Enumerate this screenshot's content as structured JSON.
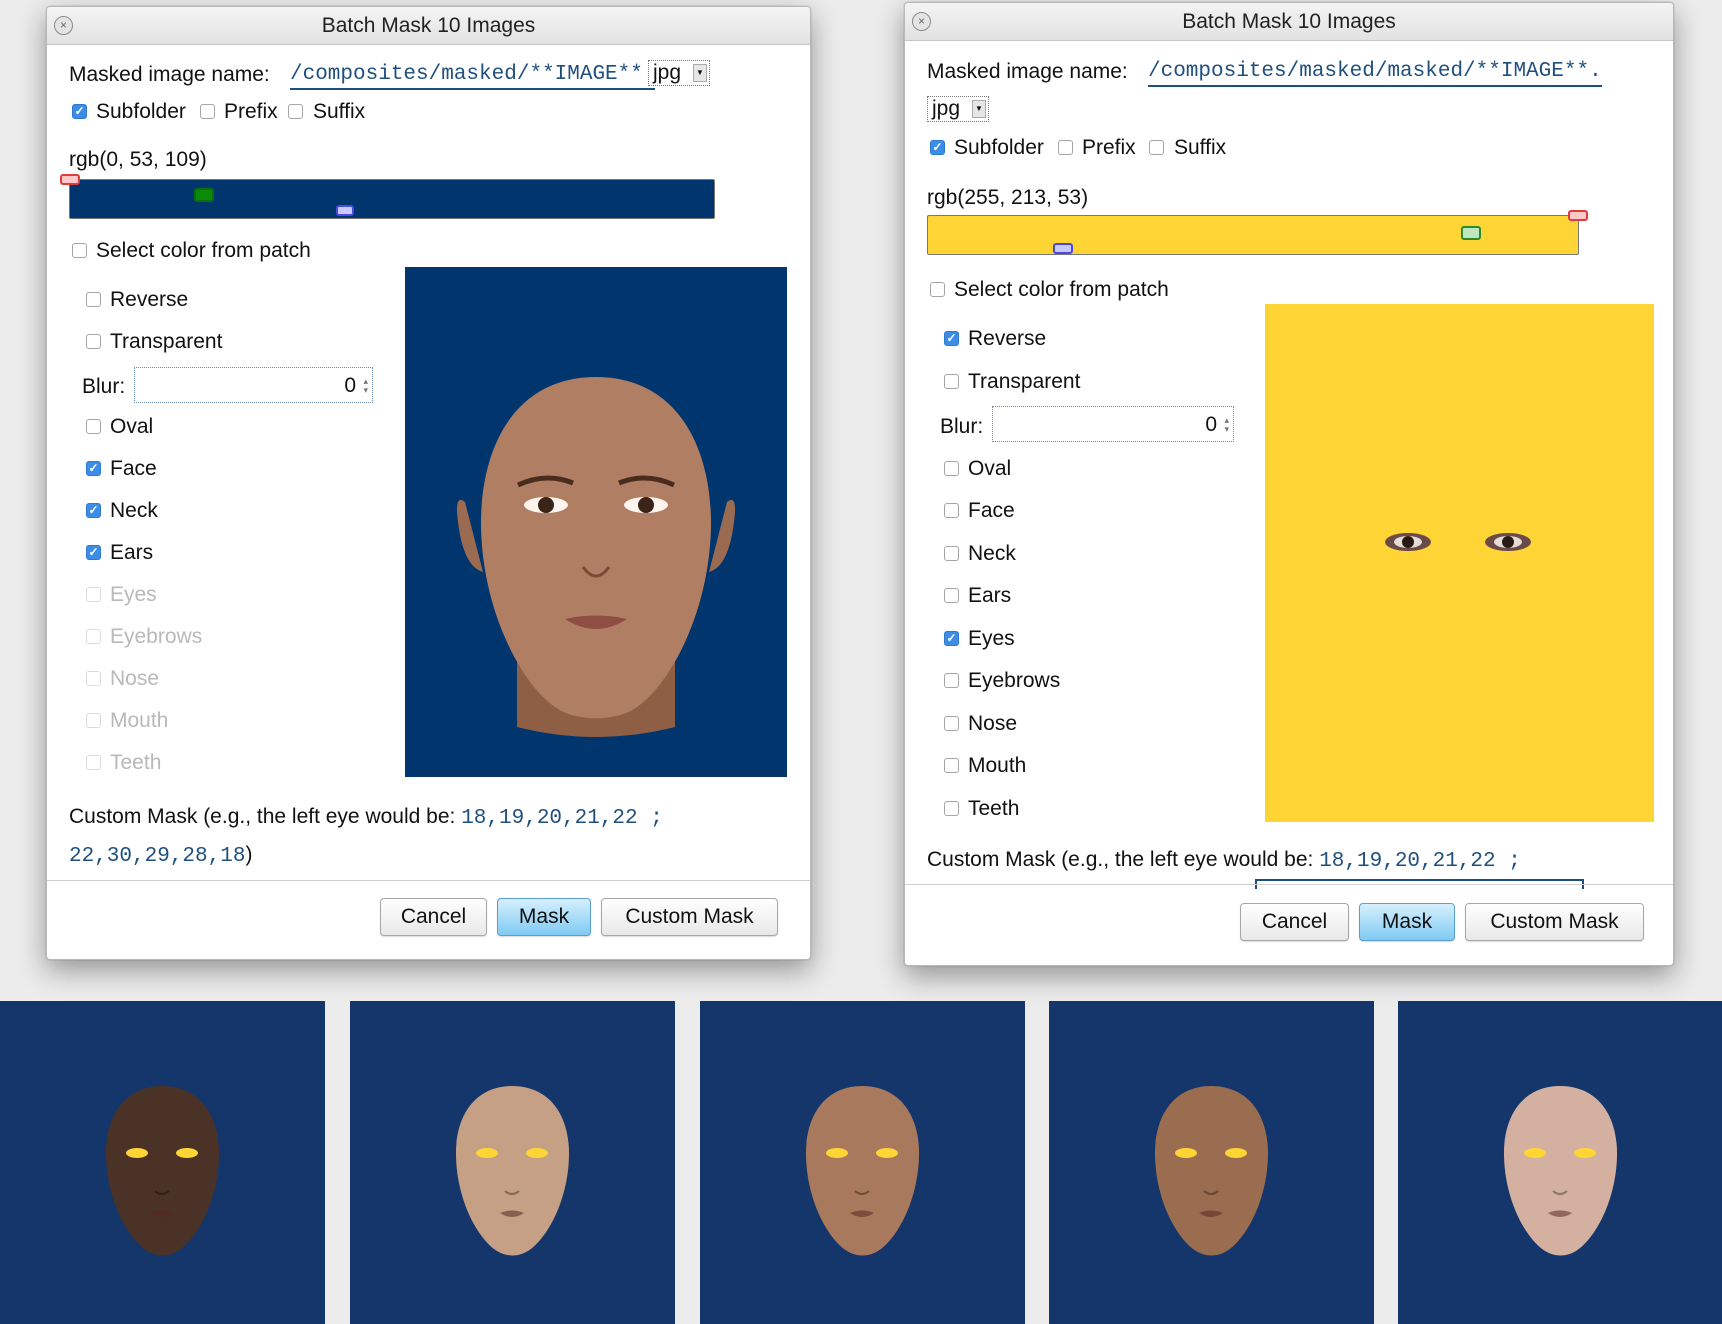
{
  "colors": {
    "blue_background": "#00356D",
    "yellow_background": "#FFD535",
    "accent_checkbox": "#3b8ee8",
    "code_text": "#1f4f7f",
    "primary_button": "#7fcaf3"
  },
  "left_dialog": {
    "title": "Batch Mask 10 Images",
    "name_label": "Masked image name:",
    "name_value": "/composites/masked/**IMAGE**.",
    "format": "jpg",
    "subfolder": "Subfolder",
    "subfolder_checked": true,
    "prefix": "Prefix",
    "prefix_checked": false,
    "suffix": "Suffix",
    "suffix_checked": false,
    "color_value": "rgb(0, 53, 109)",
    "slider_levels": {
      "red": 0,
      "green": 53,
      "blue": 109
    },
    "select_patch": "Select color from patch",
    "reverse": "Reverse",
    "transparent": "Transparent",
    "blur_label": "Blur:",
    "blur_value": "0",
    "parts": [
      {
        "label": "Oval",
        "checked": false,
        "enabled": true
      },
      {
        "label": "Face",
        "checked": true,
        "enabled": true
      },
      {
        "label": "Neck",
        "checked": true,
        "enabled": true
      },
      {
        "label": "Ears",
        "checked": true,
        "enabled": true
      },
      {
        "label": "Eyes",
        "checked": false,
        "enabled": false
      },
      {
        "label": "Eyebrows",
        "checked": false,
        "enabled": false
      },
      {
        "label": "Nose",
        "checked": false,
        "enabled": false
      },
      {
        "label": "Mouth",
        "checked": false,
        "enabled": false
      },
      {
        "label": "Teeth",
        "checked": false,
        "enabled": false
      }
    ],
    "custom_mask_text": "Custom Mask (e.g., the left eye would be:",
    "custom_mask_code_1": "18,19,20,21,22 ;",
    "custom_mask_code_2": "22,30,29,28,18",
    "custom_mask_close": ")",
    "cancel": "Cancel",
    "mask": "Mask",
    "custom_mask_button": "Custom Mask"
  },
  "right_dialog": {
    "title": "Batch Mask 10 Images",
    "name_label": "Masked image name:",
    "name_value": "/composites/masked/masked/**IMAGE**.",
    "format": "jpg",
    "subfolder": "Subfolder",
    "subfolder_checked": true,
    "prefix": "Prefix",
    "prefix_checked": false,
    "suffix": "Suffix",
    "suffix_checked": false,
    "color_value": "rgb(255, 213, 53)",
    "slider_levels": {
      "red": 255,
      "green": 213,
      "blue": 53
    },
    "select_patch": "Select color from patch",
    "reverse": "Reverse",
    "reverse_checked": true,
    "transparent": "Transparent",
    "blur_label": "Blur:",
    "blur_value": "0",
    "parts": [
      {
        "label": "Oval",
        "checked": false
      },
      {
        "label": "Face",
        "checked": false
      },
      {
        "label": "Neck",
        "checked": false
      },
      {
        "label": "Ears",
        "checked": false
      },
      {
        "label": "Eyes",
        "checked": true
      },
      {
        "label": "Eyebrows",
        "checked": false
      },
      {
        "label": "Nose",
        "checked": false
      },
      {
        "label": "Mouth",
        "checked": false
      },
      {
        "label": "Teeth",
        "checked": false
      }
    ],
    "custom_mask_text": "Custom Mask (e.g., the left eye would be:",
    "custom_mask_code_1": "18,19,20,21,22 ;",
    "cancel": "Cancel",
    "mask": "Mask",
    "custom_mask_button": "Custom Mask"
  },
  "results": [
    {
      "skin": "#4a3226"
    },
    {
      "skin": "#c6a084"
    },
    {
      "skin": "#a8795c"
    },
    {
      "skin": "#9a6c50"
    },
    {
      "skin": "#d4b0a0"
    }
  ]
}
